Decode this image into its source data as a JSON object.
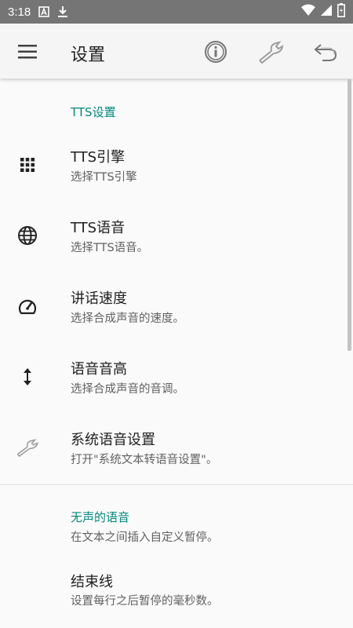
{
  "statusbar": {
    "time": "3:18"
  },
  "toolbar": {
    "title": "设置"
  },
  "sections": {
    "tts_header": "TTS设置",
    "silence_header": "无声的语音"
  },
  "items": [
    {
      "title": "TTS引擎",
      "summary": "选择TTS引擎",
      "icon": "grid-icon"
    },
    {
      "title": "TTS语音",
      "summary": "选择TTS语音。",
      "icon": "globe-icon"
    },
    {
      "title": "讲话速度",
      "summary": "选择合成声音的速度。",
      "icon": "speedometer-icon"
    },
    {
      "title": "语音音高",
      "summary": "选择合成声音的音调。",
      "icon": "vertical-arrows-icon"
    },
    {
      "title": "系统语音设置",
      "summary": "打开\"系统文本转语音设置\"。",
      "icon": "wrench-icon"
    }
  ],
  "silence": {
    "summary": "在文本之间插入自定义暂停。"
  },
  "end_line": {
    "title": "结束线",
    "summary": "设置每行之后暂停的毫秒数。"
  },
  "colors": {
    "accent": "#00897b",
    "statusbar": "#757575",
    "toolbar": "#f5f5f5"
  }
}
